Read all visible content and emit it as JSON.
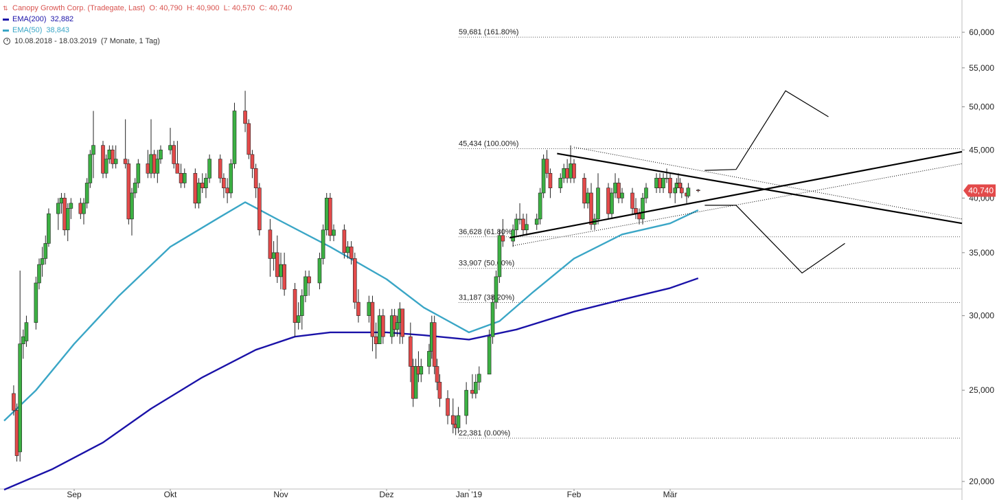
{
  "header": {
    "title": "Canopy Growth Corp. (Tradegate, Last)",
    "ohlc": "O: 40,790  H: 40,900  L: 40,570  C: 40,740",
    "ema200_label": "EMA(200)",
    "ema200_value": "32,882",
    "ema50_label": "EMA(50)",
    "ema50_value": "38,843",
    "range": "10.08.2018 - 18.03.2019",
    "period": "(7 Monate, 1 Tag)"
  },
  "colors": {
    "up": "#3cb043",
    "down": "#e34a4a",
    "ema200": "#1a12a8",
    "ema50": "#3aa6c6",
    "price_badge": "#e34a4a"
  },
  "chart_data": {
    "type": "candlestick",
    "scale": "log",
    "ylim": [
      19.5,
      62
    ],
    "y_ticks": [
      "20,000",
      "25,000",
      "30,000",
      "35,000",
      "40,000",
      "45,000",
      "50,000",
      "55,000",
      "60,000"
    ],
    "y_tick_values": [
      20,
      25,
      30,
      35,
      40,
      45,
      50,
      55,
      60
    ],
    "x_ticks": [
      "Sep",
      "Okt",
      "Nov",
      "Dez",
      "Jan '19",
      "Feb",
      "Mär"
    ],
    "x_tick_dates": [
      "2018-09-01",
      "2018-10-01",
      "2018-11-01",
      "2018-12-01",
      "2019-01-01",
      "2019-02-01",
      "2019-03-01"
    ],
    "date_range": [
      "2018-08-10",
      "2019-03-18"
    ],
    "current_price": "40,740",
    "current_value": 40.74,
    "fib_levels": [
      {
        "label": "59,681 (161.80%)",
        "value": 59.681
      },
      {
        "label": "45,434 (100.00%)",
        "value": 45.434
      },
      {
        "label": "36,628 (61.80%)",
        "value": 36.628
      },
      {
        "label": "33,907 (50.00%)",
        "value": 33.907
      },
      {
        "label": "31,187 (38.20%)",
        "value": 31.187
      },
      {
        "label": "22,381 (0.00%)",
        "value": 22.381
      }
    ],
    "series": [
      {
        "name": "EMA(200)",
        "points": [
          [
            "2018-08-10",
            19.6
          ],
          [
            "2018-08-25",
            20.6
          ],
          [
            "2018-09-10",
            22.0
          ],
          [
            "2018-09-25",
            23.9
          ],
          [
            "2018-10-10",
            25.8
          ],
          [
            "2018-10-25",
            27.6
          ],
          [
            "2018-11-05",
            28.5
          ],
          [
            "2018-11-15",
            28.8
          ],
          [
            "2018-12-01",
            28.8
          ],
          [
            "2018-12-15",
            28.6
          ],
          [
            "2019-01-01",
            28.3
          ],
          [
            "2019-01-15",
            29.0
          ],
          [
            "2019-02-01",
            30.3
          ],
          [
            "2019-02-15",
            31.2
          ],
          [
            "2019-03-01",
            32.1
          ],
          [
            "2019-03-18",
            32.88
          ]
        ]
      },
      {
        "name": "EMA(50)",
        "points": [
          [
            "2018-08-10",
            23.2
          ],
          [
            "2018-08-20",
            25.0
          ],
          [
            "2018-09-01",
            28.0
          ],
          [
            "2018-09-15",
            31.5
          ],
          [
            "2018-10-01",
            35.5
          ],
          [
            "2018-10-15",
            38.2
          ],
          [
            "2018-10-22",
            39.6
          ],
          [
            "2018-11-01",
            37.8
          ],
          [
            "2018-11-15",
            35.5
          ],
          [
            "2018-12-01",
            32.8
          ],
          [
            "2018-12-15",
            30.6
          ],
          [
            "2019-01-01",
            28.8
          ],
          [
            "2019-01-10",
            29.6
          ],
          [
            "2019-01-20",
            31.8
          ],
          [
            "2019-02-01",
            34.5
          ],
          [
            "2019-02-15",
            36.6
          ],
          [
            "2019-03-01",
            37.6
          ],
          [
            "2019-03-18",
            38.84
          ]
        ]
      }
    ],
    "candles": [
      [
        "2018-08-13",
        24.8,
        25.3,
        23.5,
        23.8
      ],
      [
        "2018-08-14",
        23.8,
        24.2,
        21.0,
        21.3
      ],
      [
        "2018-08-15",
        21.5,
        33.5,
        21.0,
        28.0
      ],
      [
        "2018-08-16",
        28.0,
        29.0,
        27.0,
        28.5
      ],
      [
        "2018-08-17",
        28.2,
        30.0,
        27.8,
        29.5
      ],
      [
        "2018-08-20",
        29.5,
        33.0,
        29.0,
        32.5
      ],
      [
        "2018-08-21",
        32.5,
        34.5,
        32.0,
        34.0
      ],
      [
        "2018-08-22",
        34.0,
        35.5,
        33.0,
        34.5
      ],
      [
        "2018-08-23",
        34.5,
        36.5,
        34.0,
        35.8
      ],
      [
        "2018-08-24",
        35.8,
        39.0,
        35.5,
        38.5
      ],
      [
        "2018-08-27",
        38.5,
        40.0,
        37.0,
        39.5
      ],
      [
        "2018-08-28",
        39.5,
        40.5,
        38.5,
        40.0
      ],
      [
        "2018-08-29",
        40.0,
        40.5,
        36.5,
        37.0
      ],
      [
        "2018-08-30",
        37.0,
        39.5,
        36.0,
        39.0
      ],
      [
        "2018-08-31",
        39.0,
        40.0,
        38.0,
        39.5
      ],
      [
        "2018-09-03",
        39.5,
        40.0,
        38.0,
        38.5
      ],
      [
        "2018-09-04",
        38.5,
        40.0,
        37.5,
        39.5
      ],
      [
        "2018-09-05",
        39.5,
        42.0,
        39.0,
        41.5
      ],
      [
        "2018-09-06",
        41.5,
        45.0,
        41.0,
        44.5
      ],
      [
        "2018-09-07",
        44.5,
        49.5,
        42.0,
        45.5
      ],
      [
        "2018-09-10",
        45.5,
        46.0,
        42.0,
        42.5
      ],
      [
        "2018-09-11",
        42.5,
        44.5,
        42.0,
        44.0
      ],
      [
        "2018-09-12",
        44.0,
        45.5,
        43.5,
        45.0
      ],
      [
        "2018-09-13",
        45.0,
        45.5,
        43.0,
        43.5
      ],
      [
        "2018-09-14",
        43.5,
        45.5,
        43.0,
        44.0
      ],
      [
        "2018-09-17",
        44.0,
        48.5,
        43.0,
        43.5
      ],
      [
        "2018-09-18",
        43.5,
        44.0,
        37.5,
        38.0
      ],
      [
        "2018-09-19",
        38.0,
        41.0,
        36.5,
        40.5
      ],
      [
        "2018-09-20",
        40.5,
        42.0,
        40.0,
        41.5
      ],
      [
        "2018-09-21",
        41.5,
        44.0,
        41.0,
        43.5
      ],
      [
        "2018-09-24",
        43.5,
        45.0,
        42.0,
        42.5
      ],
      [
        "2018-09-25",
        42.5,
        48.5,
        42.0,
        44.5
      ],
      [
        "2018-09-26",
        44.5,
        45.0,
        42.0,
        42.5
      ],
      [
        "2018-09-27",
        42.5,
        45.0,
        41.5,
        44.0
      ],
      [
        "2018-09-28",
        44.0,
        45.5,
        43.5,
        45.0
      ],
      [
        "2018-10-01",
        45.0,
        47.5,
        44.5,
        45.5
      ],
      [
        "2018-10-02",
        45.5,
        46.0,
        43.0,
        43.5
      ],
      [
        "2018-10-03",
        43.5,
        46.0,
        42.5,
        42.5
      ],
      [
        "2018-10-04",
        42.5,
        43.5,
        41.0,
        41.5
      ],
      [
        "2018-10-05",
        41.5,
        43.0,
        41.0,
        42.5
      ],
      [
        "2018-10-08",
        42.5,
        43.0,
        39.0,
        39.5
      ],
      [
        "2018-10-09",
        39.5,
        42.0,
        39.0,
        41.5
      ],
      [
        "2018-10-10",
        41.5,
        42.5,
        40.5,
        41.0
      ],
      [
        "2018-10-11",
        41.0,
        42.5,
        40.0,
        42.0
      ],
      [
        "2018-10-12",
        42.0,
        44.5,
        41.5,
        44.0
      ],
      [
        "2018-10-15",
        44.0,
        44.5,
        41.5,
        42.0
      ],
      [
        "2018-10-16",
        42.0,
        42.5,
        40.0,
        41.0
      ],
      [
        "2018-10-17",
        41.0,
        42.0,
        39.5,
        40.5
      ],
      [
        "2018-10-18",
        40.5,
        44.0,
        40.0,
        43.5
      ],
      [
        "2018-10-19",
        43.5,
        50.5,
        43.0,
        49.5
      ],
      [
        "2018-10-22",
        49.5,
        52.0,
        47.0,
        48.0
      ],
      [
        "2018-10-23",
        48.0,
        48.5,
        44.0,
        44.5
      ],
      [
        "2018-10-24",
        44.5,
        45.0,
        42.0,
        43.0
      ],
      [
        "2018-10-25",
        43.0,
        43.5,
        40.0,
        41.0
      ],
      [
        "2018-10-26",
        41.0,
        41.5,
        36.5,
        37.0
      ],
      [
        "2018-10-29",
        37.0,
        38.0,
        33.0,
        34.5
      ],
      [
        "2018-10-30",
        34.5,
        36.0,
        33.5,
        35.0
      ],
      [
        "2018-10-31",
        35.0,
        36.5,
        32.5,
        33.0
      ],
      [
        "2018-11-01",
        33.0,
        35.0,
        32.0,
        34.0
      ],
      [
        "2018-11-02",
        34.0,
        35.0,
        31.5,
        32.0
      ],
      [
        "2018-11-05",
        32.0,
        32.5,
        28.5,
        29.5
      ],
      [
        "2018-11-06",
        29.5,
        31.0,
        29.0,
        30.0
      ],
      [
        "2018-11-07",
        30.0,
        32.0,
        29.0,
        31.5
      ],
      [
        "2018-11-08",
        31.5,
        33.5,
        31.0,
        33.0
      ],
      [
        "2018-11-09",
        33.0,
        33.5,
        31.5,
        32.5
      ],
      [
        "2018-11-12",
        32.5,
        35.0,
        32.0,
        34.5
      ],
      [
        "2018-11-13",
        34.5,
        37.5,
        34.0,
        37.0
      ],
      [
        "2018-11-14",
        37.0,
        40.5,
        36.5,
        40.0
      ],
      [
        "2018-11-15",
        40.0,
        40.5,
        36.0,
        36.5
      ],
      [
        "2018-11-16",
        36.5,
        37.5,
        36.0,
        37.0
      ],
      [
        "2018-11-19",
        37.0,
        37.5,
        34.5,
        35.0
      ],
      [
        "2018-11-20",
        35.0,
        36.0,
        34.5,
        35.5
      ],
      [
        "2018-11-21",
        35.5,
        36.0,
        34.0,
        34.5
      ],
      [
        "2018-11-22",
        34.5,
        35.0,
        30.5,
        31.0
      ],
      [
        "2018-11-23",
        31.0,
        32.0,
        29.5,
        30.0
      ],
      [
        "2018-11-26",
        30.0,
        31.5,
        29.5,
        31.0
      ],
      [
        "2018-11-27",
        31.0,
        31.5,
        27.5,
        28.5
      ],
      [
        "2018-11-28",
        28.5,
        29.5,
        27.0,
        28.0
      ],
      [
        "2018-11-29",
        28.0,
        30.5,
        28.0,
        30.0
      ],
      [
        "2018-11-30",
        30.0,
        30.5,
        28.0,
        28.5
      ],
      [
        "2018-12-03",
        28.5,
        30.5,
        28.0,
        30.0
      ],
      [
        "2018-12-04",
        30.0,
        30.5,
        28.5,
        29.0
      ],
      [
        "2018-12-05",
        29.0,
        30.0,
        28.5,
        29.5
      ],
      [
        "2018-12-06",
        29.5,
        31.0,
        28.0,
        30.5
      ],
      [
        "2018-12-07",
        30.5,
        30.5,
        28.0,
        28.5
      ],
      [
        "2018-12-10",
        28.5,
        29.5,
        25.5,
        26.5
      ],
      [
        "2018-12-11",
        26.5,
        27.0,
        24.0,
        24.5
      ],
      [
        "2018-12-12",
        24.5,
        27.0,
        24.5,
        26.5
      ],
      [
        "2018-12-13",
        26.5,
        27.5,
        25.5,
        26.0
      ],
      [
        "2018-12-14",
        26.0,
        27.0,
        25.5,
        26.5
      ],
      [
        "2018-12-17",
        26.5,
        28.0,
        26.0,
        27.5
      ],
      [
        "2018-12-18",
        27.5,
        30.0,
        27.0,
        29.5
      ],
      [
        "2018-12-19",
        29.5,
        30.0,
        26.0,
        26.5
      ],
      [
        "2018-12-20",
        26.5,
        27.0,
        25.0,
        25.5
      ],
      [
        "2018-12-21",
        25.5,
        26.0,
        24.0,
        24.5
      ],
      [
        "2018-12-24",
        24.5,
        25.0,
        23.0,
        23.5
      ],
      [
        "2018-12-26",
        23.5,
        24.5,
        22.5,
        23.0
      ],
      [
        "2018-12-27",
        23.0,
        23.5,
        22.4,
        22.8
      ],
      [
        "2018-12-28",
        22.8,
        24.0,
        22.5,
        23.5
      ],
      [
        "2018-12-31",
        23.5,
        25.5,
        23.0,
        25.0
      ],
      [
        "2019-01-02",
        25.0,
        26.0,
        24.5,
        24.8
      ],
      [
        "2019-01-03",
        24.8,
        26.0,
        24.5,
        25.5
      ],
      [
        "2019-01-04",
        25.5,
        26.5,
        25.0,
        26.0
      ],
      [
        "2019-01-07",
        26.0,
        29.0,
        26.0,
        28.5
      ],
      [
        "2019-01-08",
        28.5,
        31.5,
        28.0,
        31.0
      ],
      [
        "2019-01-09",
        31.0,
        33.5,
        30.5,
        33.0
      ],
      [
        "2019-01-10",
        33.0,
        37.0,
        32.5,
        36.5
      ],
      [
        "2019-01-11",
        36.5,
        38.0,
        35.5,
        36.0
      ],
      [
        "2019-01-14",
        36.0,
        37.5,
        35.5,
        37.0
      ],
      [
        "2019-01-15",
        37.0,
        38.5,
        36.5,
        38.0
      ],
      [
        "2019-01-16",
        38.0,
        39.5,
        37.5,
        38.0
      ],
      [
        "2019-01-17",
        38.0,
        38.5,
        36.5,
        37.0
      ],
      [
        "2019-01-18",
        37.0,
        38.5,
        36.5,
        37.5
      ],
      [
        "2019-01-21",
        37.5,
        38.5,
        37.0,
        38.0
      ],
      [
        "2019-01-22",
        38.0,
        41.0,
        37.5,
        40.5
      ],
      [
        "2019-01-23",
        40.5,
        44.5,
        40.0,
        44.0
      ],
      [
        "2019-01-24",
        44.0,
        45.0,
        42.0,
        42.5
      ],
      [
        "2019-01-25",
        42.5,
        43.0,
        40.0,
        41.0
      ],
      [
        "2019-01-28",
        41.0,
        42.5,
        40.5,
        42.0
      ],
      [
        "2019-01-29",
        42.0,
        43.5,
        41.5,
        43.0
      ],
      [
        "2019-01-30",
        43.0,
        44.0,
        41.5,
        42.0
      ],
      [
        "2019-01-31",
        42.0,
        45.5,
        41.5,
        43.5
      ],
      [
        "2019-02-01",
        43.5,
        44.0,
        41.5,
        42.0
      ],
      [
        "2019-02-04",
        42.0,
        42.5,
        39.0,
        39.5
      ],
      [
        "2019-02-05",
        39.5,
        41.0,
        39.0,
        40.5
      ],
      [
        "2019-02-06",
        40.5,
        41.5,
        37.0,
        37.5
      ],
      [
        "2019-02-07",
        37.5,
        38.5,
        37.0,
        38.0
      ],
      [
        "2019-02-08",
        38.0,
        42.5,
        37.5,
        41.0
      ],
      [
        "2019-02-11",
        41.0,
        41.5,
        38.0,
        38.5
      ],
      [
        "2019-02-12",
        38.5,
        41.0,
        38.0,
        40.5
      ],
      [
        "2019-02-13",
        40.5,
        42.5,
        40.0,
        41.5
      ],
      [
        "2019-02-14",
        41.5,
        42.0,
        39.5,
        40.0
      ],
      [
        "2019-02-15",
        40.0,
        41.0,
        39.5,
        40.5
      ],
      [
        "2019-02-18",
        40.5,
        41.0,
        38.5,
        39.0
      ],
      [
        "2019-02-19",
        39.0,
        40.0,
        38.0,
        38.5
      ],
      [
        "2019-02-20",
        38.5,
        39.0,
        37.5,
        38.0
      ],
      [
        "2019-02-21",
        38.0,
        40.5,
        37.5,
        40.0
      ],
      [
        "2019-02-22",
        40.0,
        41.5,
        39.5,
        41.0
      ],
      [
        "2019-02-25",
        41.0,
        42.5,
        40.5,
        42.0
      ],
      [
        "2019-02-26",
        42.0,
        42.5,
        40.5,
        41.0
      ],
      [
        "2019-02-27",
        41.0,
        42.5,
        40.5,
        42.0
      ],
      [
        "2019-02-28",
        42.0,
        43.0,
        41.5,
        42.0
      ],
      [
        "2019-03-01",
        42.0,
        42.5,
        40.0,
        40.5
      ],
      [
        "2019-03-04",
        40.5,
        41.5,
        39.5,
        41.0
      ],
      [
        "2019-03-05",
        41.0,
        42.0,
        40.5,
        41.5
      ],
      [
        "2019-03-06",
        41.5,
        42.5,
        41.0,
        41.5
      ],
      [
        "2019-03-07",
        41.5,
        42.0,
        40.5,
        41.0
      ],
      [
        "2019-03-08",
        41.0,
        41.5,
        40.0,
        40.5
      ],
      [
        "2019-03-11",
        40.5,
        41.0,
        39.5,
        40.2
      ],
      [
        "2019-03-12",
        40.2,
        41.5,
        40.0,
        41.0
      ],
      [
        "2019-03-18",
        40.79,
        40.9,
        40.57,
        40.74
      ]
    ],
    "trendlines": [
      {
        "style": "solid",
        "from": [
          "2019-01-13",
          36.3
        ],
        "to": [
          "2019-08-25",
          44.8
        ]
      },
      {
        "style": "solid",
        "from": [
          "2019-01-27",
          44.6
        ],
        "to": [
          "2019-08-25",
          37.6
        ]
      },
      {
        "style": "dotted",
        "from": [
          "2019-01-14",
          35.6
        ],
        "to": [
          "2019-08-25",
          43.5
        ]
      },
      {
        "style": "dotted",
        "from": [
          "2019-02-01",
          45.3
        ],
        "to": [
          "2019-08-25",
          38.0
        ]
      }
    ],
    "scenarios": [
      {
        "name": "up",
        "points": [
          [
            "2019-03-22",
            42.8
          ],
          [
            "2019-04-10",
            42.9
          ],
          [
            "2019-05-10",
            52.0
          ],
          [
            "2019-06-05",
            48.8
          ]
        ]
      },
      {
        "name": "down",
        "points": [
          [
            "2019-03-22",
            39.3
          ],
          [
            "2019-04-10",
            39.3
          ],
          [
            "2019-05-20",
            33.3
          ],
          [
            "2019-06-15",
            35.8
          ]
        ]
      }
    ]
  }
}
